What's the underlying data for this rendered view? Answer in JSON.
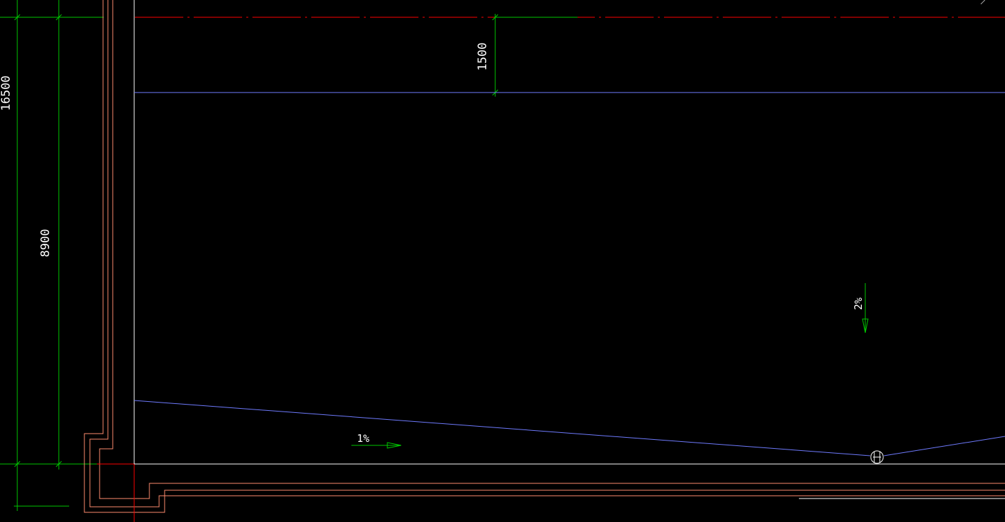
{
  "drawing": {
    "colors": {
      "background": "#000000",
      "dimension": "#00c800",
      "wall": "#ffffff",
      "outline": "#ff8c6e",
      "axis": "#ff0000",
      "slab_edge": "#6f7bff"
    },
    "dimensions": {
      "overall": "16500",
      "inner": "8900",
      "top_offset": "1500"
    },
    "slopes": {
      "horizontal": "1%",
      "vertical": "2%"
    },
    "icons": {
      "drain": "floor-drain-icon"
    }
  }
}
